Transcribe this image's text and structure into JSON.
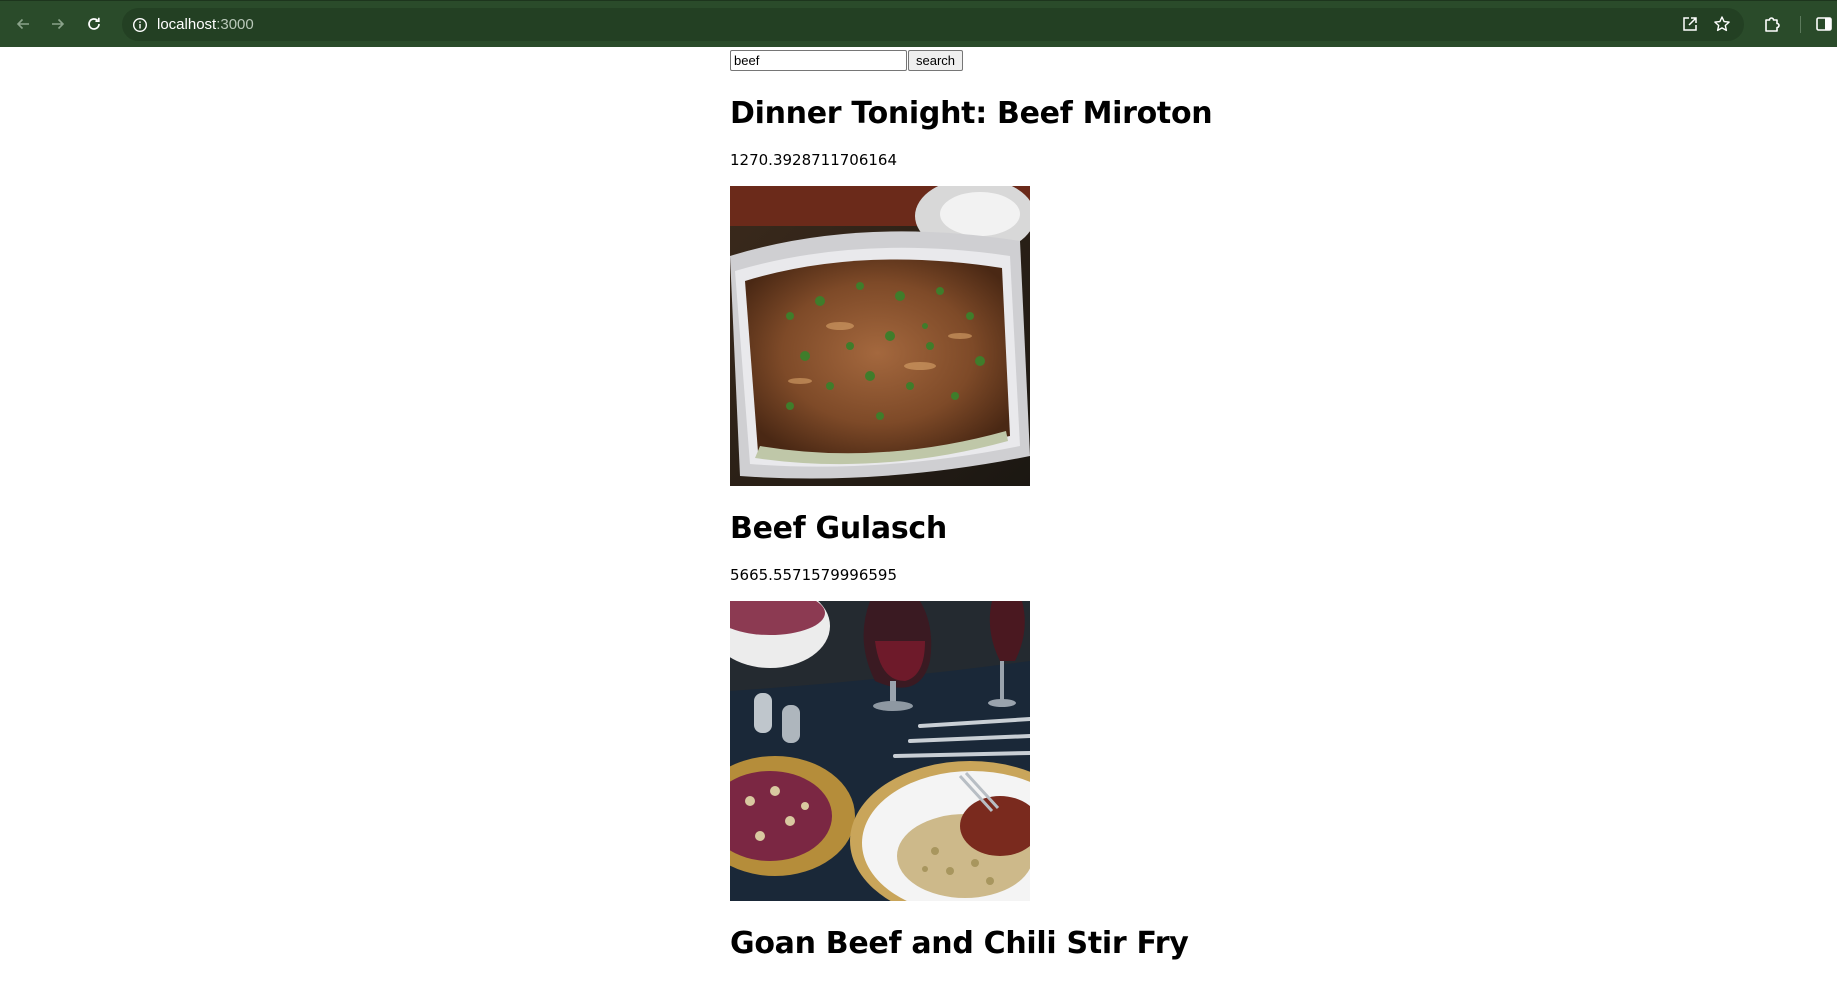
{
  "browser": {
    "url_host": "localhost",
    "url_port": ":3000",
    "toolbar_color": "#2a4b2a",
    "icons": [
      "back-arrow-icon",
      "forward-arrow-icon",
      "reload-icon",
      "site-info-icon",
      "open-in-new-icon",
      "bookmark-star-icon",
      "extensions-puzzle-icon",
      "side-panel-icon"
    ]
  },
  "search": {
    "value": "beef",
    "button_label": "search"
  },
  "recipes": [
    {
      "title": "Dinner Tonight: Beef Miroton",
      "score": "1270.3928711706164",
      "image": "baked-beef-casserole-photo"
    },
    {
      "title": "Beef Gulasch",
      "score": "5665.5571579996595",
      "image": "dinner-table-goulash-photo"
    },
    {
      "title": "Goan Beef and Chili Stir Fry"
    }
  ]
}
